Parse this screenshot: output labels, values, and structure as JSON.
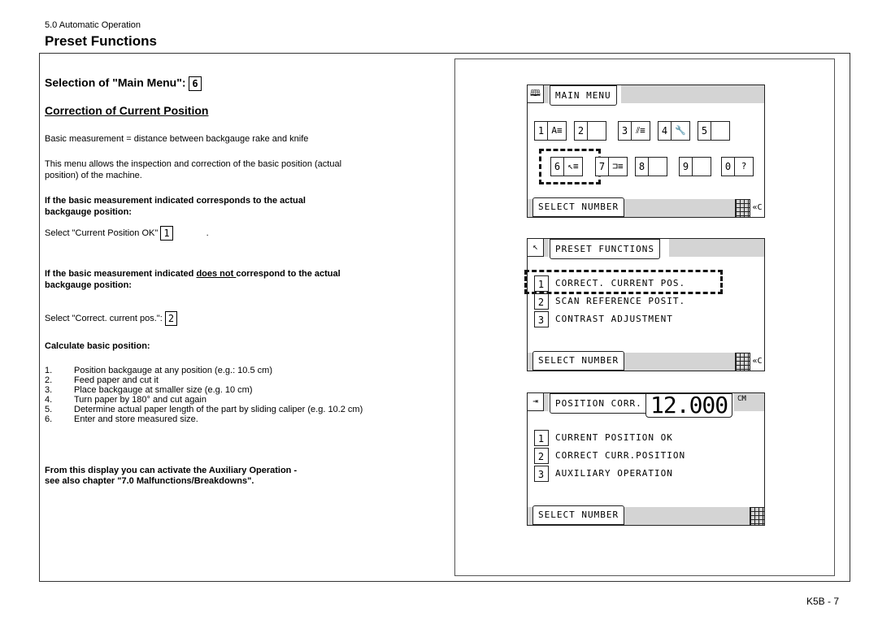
{
  "header": {
    "section": "5.0 Automatic Operation",
    "title": "Preset Functions"
  },
  "left": {
    "selection_heading": "Selection of \"Main Menu\":",
    "selection_key": "6",
    "subheading": "Correction of Current Position",
    "definition": "Basic measurement = distance between backgauge rake and knife",
    "intro_line1": "This menu allows the inspection and correction of the basic position (actual",
    "intro_line2": "position) of the machine.",
    "case1_line1": "If the basic measurement indicated corresponds to the actual",
    "case1_line2": "backgauge position:",
    "case1_action": "Select \"Current Position OK\"",
    "case1_key": "1",
    "case1_trailing": ".",
    "case2_pre": "If the basic measurement indicated ",
    "case2_underlined": "does not ",
    "case2_post": "correspond to the actual",
    "case2_line2": "backgauge position:",
    "case2_action": "Select \"Correct. current pos.\":",
    "case2_key": "2",
    "calc_heading": "Calculate basic position:",
    "steps": [
      {
        "num": "1.",
        "text": "Position backgauge at any position (e.g.: 10.5 cm)"
      },
      {
        "num": "2.",
        "text": "Feed paper and cut it"
      },
      {
        "num": "3.",
        "text": "Place backgauge at smaller size (e.g. 10 cm)"
      },
      {
        "num": "4.",
        "text": "Turn paper by 180° and cut again"
      },
      {
        "num": "5.",
        "text": "Determine actual paper length of the part by sliding caliper (e.g. 10.2 cm)"
      },
      {
        "num": "6.",
        "text": "Enter and store measured size."
      }
    ],
    "note_line1": "From this display you can activate the Auxiliary Operation -",
    "note_line2": "see also chapter \"7.0 Malfunctions/Breakdowns\"."
  },
  "screens": {
    "main_menu": {
      "title": "MAIN MENU",
      "icon": "book-icon",
      "bottom_label": "SELECT NUMBER",
      "clear_label": "«C",
      "keys": [
        {
          "num": "1",
          "icon": "program-icon",
          "glyph": "A≡"
        },
        {
          "num": "2",
          "icon": "blank",
          "glyph": ""
        },
        {
          "num": "3",
          "icon": "cut-icon",
          "glyph": "⫽≡"
        },
        {
          "num": "4",
          "icon": "wrench-icon",
          "glyph": "🔧"
        },
        {
          "num": "5",
          "icon": "blank",
          "glyph": ""
        },
        {
          "num": "6",
          "icon": "preset-icon",
          "glyph": "↖≡"
        },
        {
          "num": "7",
          "icon": "stack-icon",
          "glyph": "⊐≡"
        },
        {
          "num": "8",
          "icon": "blank",
          "glyph": ""
        },
        {
          "num": "9",
          "icon": "blank",
          "glyph": ""
        },
        {
          "num": "0",
          "icon": "help-icon",
          "glyph": "?"
        }
      ],
      "highlighted_key": "6"
    },
    "preset_functions": {
      "title": "PRESET FUNCTIONS",
      "bottom_label": "SELECT NUMBER",
      "clear_label": "«C",
      "options": [
        {
          "key": "1",
          "label": "CORRECT. CURRENT POS."
        },
        {
          "key": "2",
          "label": "SCAN REFERENCE POSIT."
        },
        {
          "key": "3",
          "label": "CONTRAST ADJUSTMENT"
        }
      ],
      "highlighted_option": "1"
    },
    "position_corr": {
      "title": "POSITION CORR.",
      "value": "12.000",
      "unit": "CM",
      "bottom_label": "SELECT NUMBER",
      "options": [
        {
          "key": "1",
          "label": "CURRENT POSITION OK"
        },
        {
          "key": "2",
          "label": "CORRECT CURR.POSITION"
        },
        {
          "key": "3",
          "label": "AUXILIARY OPERATION"
        }
      ]
    }
  },
  "footer": {
    "page": "K5B - 7"
  }
}
